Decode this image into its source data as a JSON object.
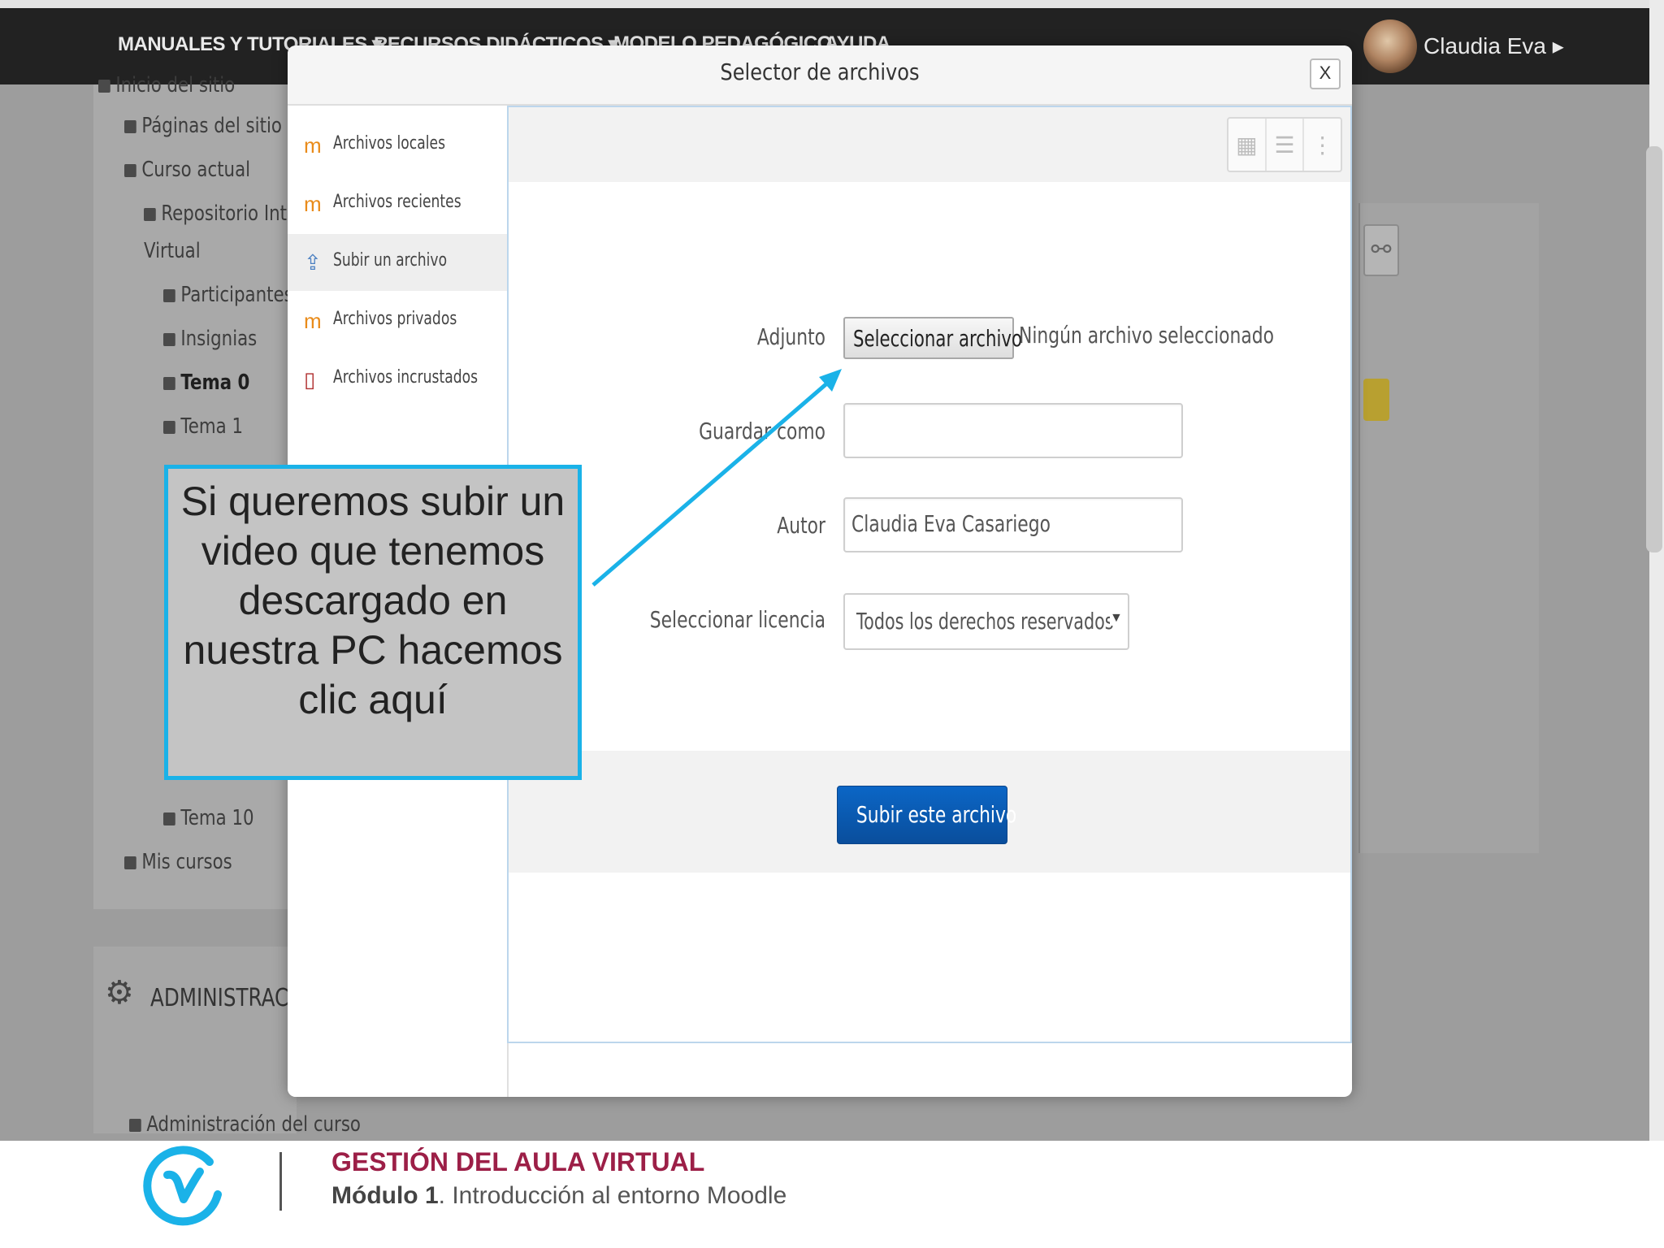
{
  "navbar": {
    "items": [
      "MANUALES Y TUTORIALES ▾",
      "RECURSOS DIDÁCTICOS ▾",
      "MODELO PEDAGÓGICO",
      "AYUDA"
    ],
    "user_name": "Claudia Eva ▸"
  },
  "site_nav": {
    "items": [
      {
        "label": "Inicio del sitio"
      },
      {
        "label": "Páginas del sitio"
      },
      {
        "label": "Curso actual"
      },
      {
        "label": "Repositorio Int"
      },
      {
        "label": "Virtual"
      },
      {
        "label": "Participantes"
      },
      {
        "label": "Insignias"
      },
      {
        "label": "Tema 0"
      },
      {
        "label": "Tema 1"
      },
      {
        "label": "Tema 10"
      },
      {
        "label": "Mis cursos"
      }
    ]
  },
  "admin_block": {
    "title": "ADMINISTRAC",
    "item": "Administración del curso"
  },
  "modal": {
    "title": "Selector de archivos",
    "close_label": "X",
    "repositories": [
      {
        "label": "Archivos locales",
        "icon": "moodle-icon"
      },
      {
        "label": "Archivos recientes",
        "icon": "moodle-icon"
      },
      {
        "label": "Subir un archivo",
        "icon": "upload-icon"
      },
      {
        "label": "Archivos privados",
        "icon": "moodle-icon"
      },
      {
        "label": "Archivos incrustados",
        "icon": "document-icon"
      }
    ],
    "active_repository": "Subir un archivo",
    "view_buttons": [
      "icons-view-icon",
      "list-view-icon",
      "tree-view-icon"
    ],
    "form": {
      "attachment_label": "Adjunto",
      "choose_file_label": "Seleccionar archivo",
      "no_file_text": "Ningún archivo seleccionado",
      "save_as_label": "Guardar como",
      "save_as_value": "",
      "author_label": "Autor",
      "author_value": "Claudia Eva Casariego",
      "license_label": "Seleccionar licencia",
      "license_value": "Todos los derechos reservados",
      "upload_button": "Subir este archivo"
    }
  },
  "callout": {
    "text": "Si queremos subir un video que tenemos descargado en nuestra PC hacemos clic aquí"
  },
  "footer": {
    "title": "GESTIÓN DEL AULA VIRTUAL",
    "module_bold": "Módulo 1",
    "module_rest": ". Introducción al entorno Moodle"
  },
  "colors": {
    "navbar": "#222222",
    "callout_border": "#1ab2e8",
    "primary_button": "#0a5cb5",
    "footer_title": "#9c1f47",
    "logo": "#1ab2e8"
  }
}
